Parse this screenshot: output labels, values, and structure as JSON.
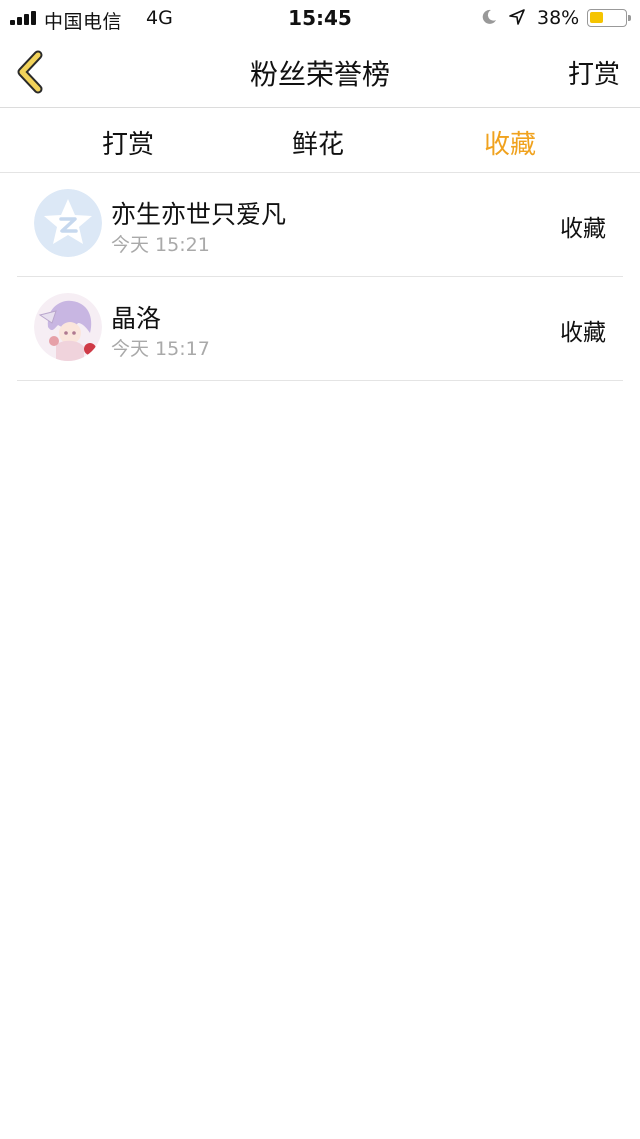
{
  "status_bar": {
    "carrier": "中国电信",
    "network": "4G",
    "time": "15:45",
    "battery_percent_text": "38%",
    "battery_level": 0.38,
    "battery_color": "#f5c400"
  },
  "nav": {
    "back_icon": "chevron-left-icon",
    "title": "粉丝荣誉榜",
    "right_action": "打赏",
    "accent_color": "#f0a21e"
  },
  "tabs": [
    {
      "label": "打赏",
      "active": false
    },
    {
      "label": "鲜花",
      "active": false
    },
    {
      "label": "收藏",
      "active": true
    }
  ],
  "list": [
    {
      "name": "亦生亦世只爱凡",
      "time": "今天 15:21",
      "action": "收藏",
      "avatar": "default-qzone-avatar"
    },
    {
      "name": "晶洛",
      "time": "今天 15:17",
      "action": "收藏",
      "avatar": "anime-girl-avatar"
    }
  ]
}
